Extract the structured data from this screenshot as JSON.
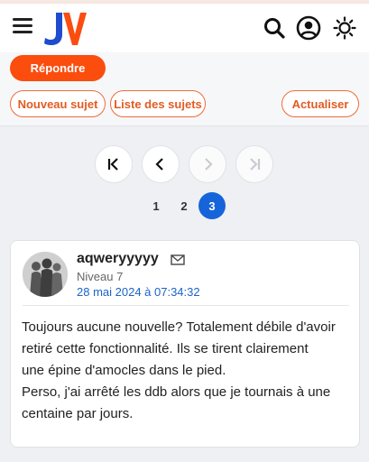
{
  "colors": {
    "accent_orange": "#fb4d0e",
    "logo_blue": "#1f4ccf",
    "logo_orange": "#fb4d0e",
    "link_blue": "#1a64c9",
    "active_page": "#1664d9"
  },
  "header": {
    "logo_text": "JV",
    "icons": [
      "menu-icon",
      "search-icon",
      "account-icon",
      "theme-toggle-icon"
    ]
  },
  "actions": {
    "reply_label": "Répondre",
    "new_topic_label": "Nouveau sujet",
    "topic_list_label": "Liste des sujets",
    "refresh_label": "Actualiser"
  },
  "pagination": {
    "controls": [
      "first-page-icon",
      "prev-page-icon",
      "next-page-icon",
      "last-page-icon"
    ],
    "pages": [
      "1",
      "2",
      "3"
    ],
    "current": "3"
  },
  "post": {
    "username": "aqweryyyyy",
    "level": "Niveau 7",
    "date": "28 mai 2024 à 07:34:32",
    "lines": [
      "Toujours aucune nouvelle? Totalement débile d'avoir",
      "retiré cette fonctionnalité. Ils se tirent clairement",
      "une épine d'amocles dans le pied.",
      "Perso, j'ai arrêté les ddb alors que je tournais à une",
      "centaine par jours."
    ]
  }
}
